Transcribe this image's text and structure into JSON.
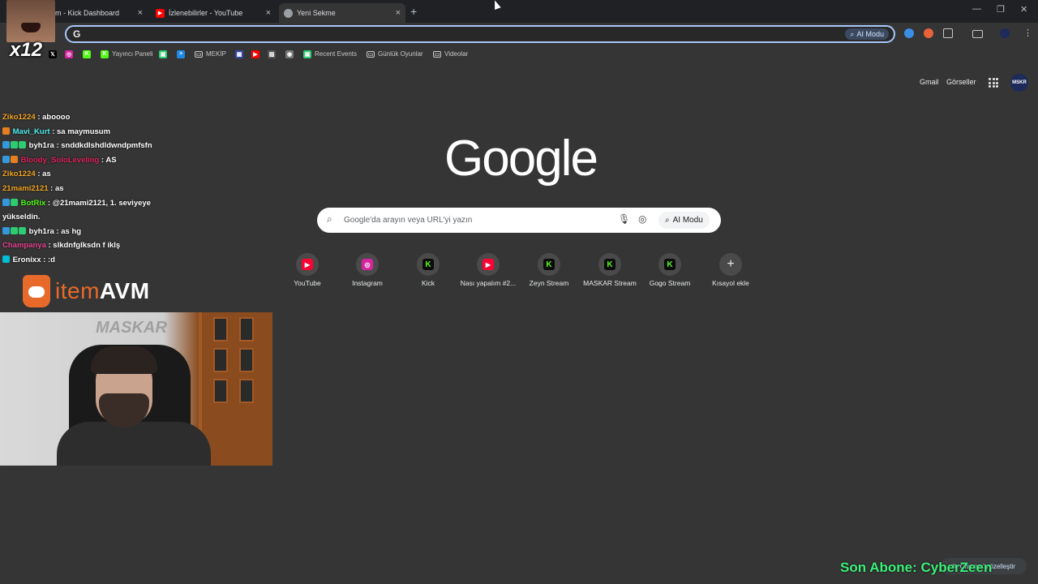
{
  "browser": {
    "tabs": [
      {
        "label": "m - Kick Dashboard",
        "icon": "kick-icon"
      },
      {
        "label": "İzlenebilirler - YouTube",
        "icon": "youtube-icon"
      },
      {
        "label": "Yeni Sekme",
        "icon": "chrome-icon"
      }
    ],
    "new_tab_label": "+",
    "omnibox": {
      "value": "",
      "g_label": "G",
      "ai_mode_label": "AI Modu"
    },
    "window_controls": {
      "minimize": "—",
      "maximize": "❐",
      "close": "✕"
    }
  },
  "bookmarks": [
    {
      "label": "",
      "icon": "x-icon",
      "glyph": "𝕏",
      "color": "#000000"
    },
    {
      "label": "",
      "icon": "instagram-icon",
      "glyph": "◎",
      "color": "#d6249f"
    },
    {
      "label": "",
      "icon": "kick-icon",
      "glyph": "K",
      "color": "#53fc18"
    },
    {
      "label": "Yayıncı Paneli",
      "icon": "kick-icon",
      "glyph": "K",
      "color": "#53fc18"
    },
    {
      "label": "",
      "icon": "app-icon",
      "glyph": "▣",
      "color": "#2ecc71"
    },
    {
      "label": "",
      "icon": "terminal-icon",
      "glyph": ">",
      "color": "#1e88e5"
    },
    {
      "label": "MEKİP",
      "icon": "folder-icon",
      "glyph": "▭",
      "color": "#353535"
    },
    {
      "label": "",
      "icon": "grid-icon",
      "glyph": "▦",
      "color": "#3949ab"
    },
    {
      "label": "",
      "icon": "youtube-icon",
      "glyph": "▶",
      "color": "#ff0000"
    },
    {
      "label": "",
      "icon": "image-icon",
      "glyph": "▨",
      "color": "#555555"
    },
    {
      "label": "",
      "icon": "circle-icon",
      "glyph": "◉",
      "color": "#777777"
    },
    {
      "label": "Recent Events",
      "icon": "app-icon",
      "glyph": "▣",
      "color": "#2ecc71"
    },
    {
      "label": "Günlük Oyunlar",
      "icon": "folder-icon",
      "glyph": "▭",
      "color": "#353535"
    },
    {
      "label": "Videolar",
      "icon": "folder-icon",
      "glyph": "▭",
      "color": "#353535"
    }
  ],
  "header": {
    "gmail": "Gmail",
    "images": "Görseller",
    "avatar_text": "MSKR"
  },
  "google": {
    "logo": "Google",
    "search_placeholder": "Google'da arayın veya URL'yi yazın",
    "ai_mode_label": "AI Modu"
  },
  "shortcuts": [
    {
      "label": "YouTube",
      "icon": "youtube-icon",
      "glyph": "▶",
      "color": "#ff0033"
    },
    {
      "label": "Instagram",
      "icon": "instagram-icon",
      "glyph": "◎",
      "color": "#d6249f"
    },
    {
      "label": "Kick",
      "icon": "kick-icon",
      "glyph": "K",
      "color": "#53fc18"
    },
    {
      "label": "Nası yapalım #2...",
      "icon": "youtube-icon",
      "glyph": "▶",
      "color": "#ff0033"
    },
    {
      "label": "Zeyn Stream",
      "icon": "kick-icon",
      "glyph": "K",
      "color": "#53fc18"
    },
    {
      "label": "MASKAR Stream",
      "icon": "kick-icon",
      "glyph": "K",
      "color": "#53fc18"
    },
    {
      "label": "Gogo Stream",
      "icon": "kick-icon",
      "glyph": "K",
      "color": "#53fc18"
    },
    {
      "label": "Kısayol ekle",
      "icon": "plus-icon",
      "glyph": "+",
      "color": "#4a4a4a"
    }
  ],
  "chat": [
    {
      "user": "Ziko1224",
      "color": "#f5a623",
      "msg": ": aboooo",
      "badges": []
    },
    {
      "user": "Mavi_Kurt",
      "color": "#4ff0f0",
      "msg": ": sa maymusum",
      "badges": [
        "#e67e22"
      ]
    },
    {
      "user": "byh1ra",
      "color": "#ffffff",
      "msg": ": snddkdlshdldwndpmfsfn",
      "badges": [
        "#3498db",
        "#2ecc71",
        "#2ecc71"
      ]
    },
    {
      "user": "Bloody_SoloLeveling",
      "color": "#e0245e",
      "msg": ": AS",
      "badges": [
        "#3498db",
        "#e67e22"
      ]
    },
    {
      "user": "Ziko1224",
      "color": "#f5a623",
      "msg": ": as",
      "badges": []
    },
    {
      "user": "21mami2121",
      "color": "#f5a623",
      "msg": ": as",
      "badges": []
    },
    {
      "user": "BotRix",
      "color": "#53fc18",
      "msg": ": @21mami2121, 1. seviyeye yükseldin.",
      "badges": [
        "#3498db",
        "#2ecc71"
      ]
    },
    {
      "user": "byh1ra",
      "color": "#ffffff",
      "msg": ": as hg",
      "badges": [
        "#3498db",
        "#2ecc71",
        "#2ecc71"
      ]
    },
    {
      "user": "Champanya",
      "color": "#e84393",
      "msg": ": slkdnfglksdn f iklş",
      "badges": []
    },
    {
      "user": "Eronixx",
      "color": "#ffffff",
      "msg": ": :d",
      "badges": [
        "#00bcd4"
      ]
    }
  ],
  "overlay": {
    "sponsor_prefix": "item",
    "sponsor_suffix": "AVM",
    "multiplier": "x12",
    "webcam_watermark": "MASKAR",
    "last_sub": "Son Abone: CyberZeen",
    "customize_chrome": "Chrome'u özelleştir"
  }
}
